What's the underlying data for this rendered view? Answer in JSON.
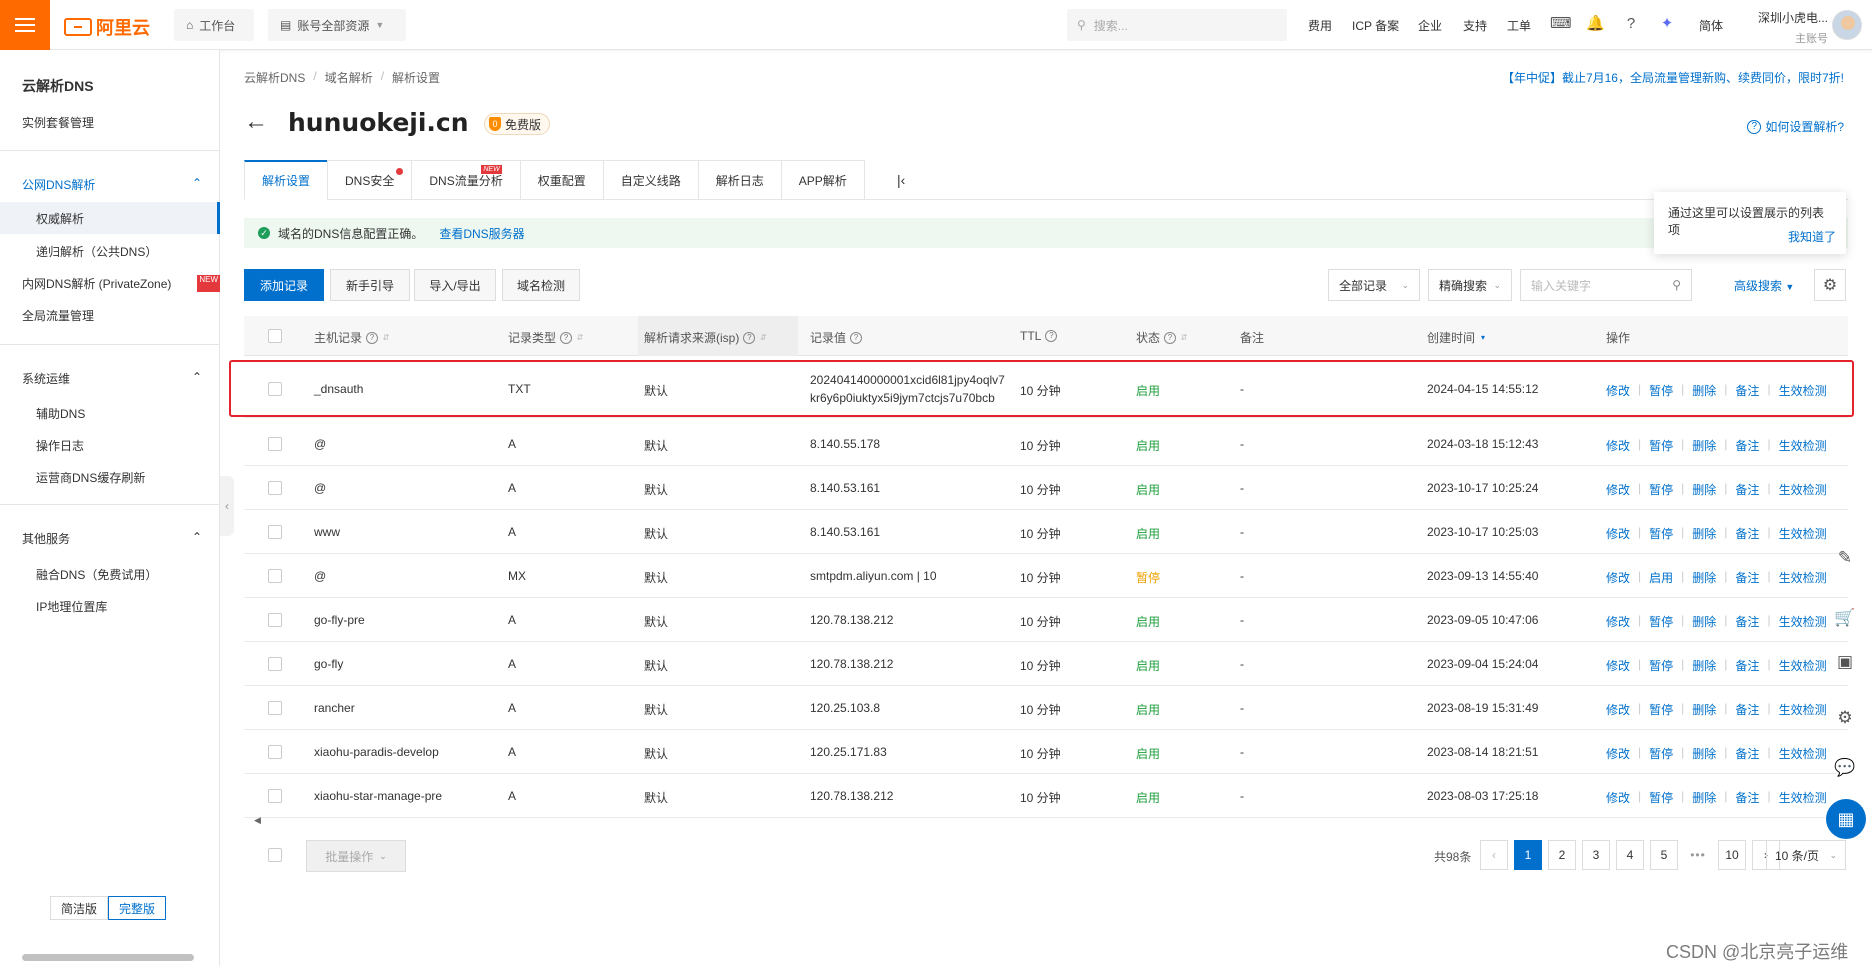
{
  "topbar": {
    "brand": "阿里云",
    "workbench": "工作台",
    "resource_scope": "账号全部资源",
    "search_placeholder": "搜索...",
    "links": [
      "费用",
      "ICP 备案",
      "企业",
      "支持",
      "工单"
    ],
    "lang": "简体",
    "account_name": "深圳小虎电...",
    "account_role": "主账号"
  },
  "sidebar": {
    "title": "云解析DNS",
    "instance_mgmt": "实例套餐管理",
    "public_dns": "公网DNS解析",
    "authoritative": "权威解析",
    "recursive": "递归解析（公共DNS）",
    "private_zone": "内网DNS解析 (PrivateZone)",
    "new_tag": "NEW",
    "gtm": "全局流量管理",
    "ops": "系统运维",
    "assist_dns": "辅助DNS",
    "op_log": "操作日志",
    "isp_refresh": "运营商DNS缓存刷新",
    "other": "其他服务",
    "fusion_dns": "融合DNS（免费试用）",
    "ip_geo": "IP地理位置库",
    "mode_simple": "简洁版",
    "mode_full": "完整版"
  },
  "breadcrumb": [
    "云解析DNS",
    "域名解析",
    "解析设置"
  ],
  "promo": "【年中促】截止7月16，全局流量管理新购、续费同价，限时7折!",
  "domain": "hunuokeji.cn",
  "edition": "免费版",
  "help_link": "如何设置解析?",
  "tabs": [
    "解析设置",
    "DNS安全",
    "DNS流量分析",
    "权重配置",
    "自定义线路",
    "解析日志",
    "APP解析"
  ],
  "tab_new": "NEW",
  "notice": {
    "text": "域名的DNS信息配置正确。",
    "link": "查看DNS服务器"
  },
  "tooltip": {
    "text": "通过这里可以设置展示的列表项",
    "ok": "我知道了"
  },
  "toolbar": {
    "add": "添加记录",
    "guide": "新手引导",
    "import_export": "导入/导出",
    "check": "域名检测",
    "all_records": "全部记录",
    "exact_search": "精确搜索",
    "keyword_placeholder": "输入关键字",
    "advanced": "高级搜索"
  },
  "columns": {
    "host": "主机记录",
    "type": "记录类型",
    "isp": "解析请求来源(isp)",
    "value": "记录值",
    "ttl": "TTL",
    "status": "状态",
    "remark": "备注",
    "created": "创建时间",
    "ops": "操作"
  },
  "records": [
    {
      "host": "_dnsauth",
      "type": "TXT",
      "isp": "默认",
      "value1": "202404140000001xcid6l81jpy4oqlv7",
      "value2": "kr6y6p0iuktyx5i9jym7ctcjs7u70bcb",
      "ttl": "10 分钟",
      "status": "启用",
      "remark": "-",
      "created": "2024-04-15 14:55:12",
      "toggle": "暂停"
    },
    {
      "host": "@",
      "type": "A",
      "isp": "默认",
      "value1": "8.140.55.178",
      "value2": "",
      "ttl": "10 分钟",
      "status": "启用",
      "remark": "-",
      "created": "2024-03-18 15:12:43",
      "toggle": "暂停"
    },
    {
      "host": "@",
      "type": "A",
      "isp": "默认",
      "value1": "8.140.53.161",
      "value2": "",
      "ttl": "10 分钟",
      "status": "启用",
      "remark": "-",
      "created": "2023-10-17 10:25:24",
      "toggle": "暂停"
    },
    {
      "host": "www",
      "type": "A",
      "isp": "默认",
      "value1": "8.140.53.161",
      "value2": "",
      "ttl": "10 分钟",
      "status": "启用",
      "remark": "-",
      "created": "2023-10-17 10:25:03",
      "toggle": "暂停"
    },
    {
      "host": "@",
      "type": "MX",
      "isp": "默认",
      "value1": "smtpdm.aliyun.com | 10",
      "value2": "",
      "ttl": "10 分钟",
      "status": "暂停",
      "remark": "-",
      "created": "2023-09-13 14:55:40",
      "toggle": "启用"
    },
    {
      "host": "go-fly-pre",
      "type": "A",
      "isp": "默认",
      "value1": "120.78.138.212",
      "value2": "",
      "ttl": "10 分钟",
      "status": "启用",
      "remark": "-",
      "created": "2023-09-05 10:47:06",
      "toggle": "暂停"
    },
    {
      "host": "go-fly",
      "type": "A",
      "isp": "默认",
      "value1": "120.78.138.212",
      "value2": "",
      "ttl": "10 分钟",
      "status": "启用",
      "remark": "-",
      "created": "2023-09-04 15:24:04",
      "toggle": "暂停"
    },
    {
      "host": "rancher",
      "type": "A",
      "isp": "默认",
      "value1": "120.25.103.8",
      "value2": "",
      "ttl": "10 分钟",
      "status": "启用",
      "remark": "-",
      "created": "2023-08-19 15:31:49",
      "toggle": "暂停"
    },
    {
      "host": "xiaohu-paradis-develop",
      "type": "A",
      "isp": "默认",
      "value1": "120.25.171.83",
      "value2": "",
      "ttl": "10 分钟",
      "status": "启用",
      "remark": "-",
      "created": "2023-08-14 18:21:51",
      "toggle": "暂停"
    },
    {
      "host": "xiaohu-star-manage-pre",
      "type": "A",
      "isp": "默认",
      "value1": "120.78.138.212",
      "value2": "",
      "ttl": "10 分钟",
      "status": "启用",
      "remark": "-",
      "created": "2023-08-03 17:25:18",
      "toggle": "暂停"
    }
  ],
  "op_labels": {
    "edit": "修改",
    "delete": "删除",
    "remark": "备注",
    "check": "生效检测"
  },
  "footer": {
    "batch": "批量操作",
    "total": "共98条",
    "pages": [
      "1",
      "2",
      "3",
      "4",
      "5",
      "10"
    ],
    "ellipsis": "•••",
    "per_page": "10 条/页"
  },
  "watermark": "CSDN @北京亮子运维",
  "colors": {
    "accent": "#0070cc",
    "brand": "#ff6a00",
    "enabled": "#1e9e3c",
    "paused": "#f0a000",
    "highlight": "#e4232c"
  }
}
